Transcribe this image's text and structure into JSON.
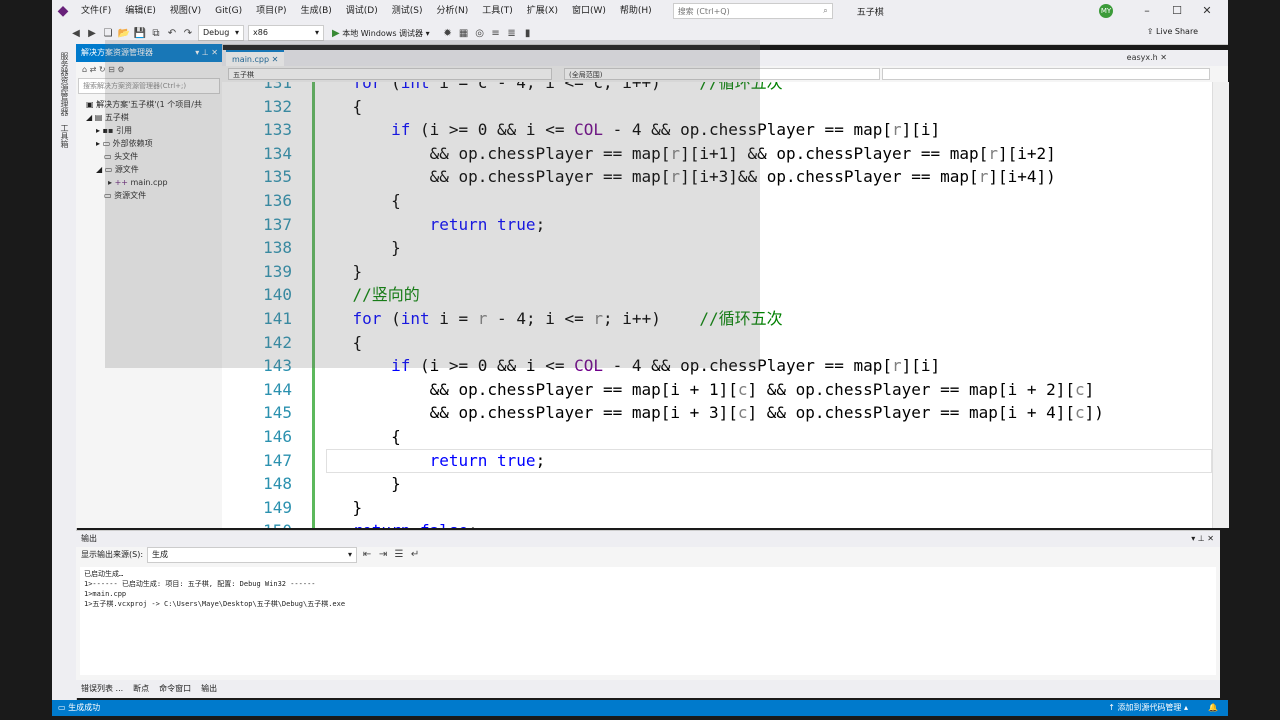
{
  "menu": {
    "items": [
      "文件(F)",
      "编辑(E)",
      "视图(V)",
      "Git(G)",
      "项目(P)",
      "生成(B)",
      "调试(D)",
      "测试(S)",
      "分析(N)",
      "工具(T)",
      "扩展(X)",
      "窗口(W)",
      "帮助(H)"
    ],
    "search_placeholder": "搜索 (Ctrl+Q)",
    "solution_name": "五子棋",
    "avatar": "MY"
  },
  "toolbar": {
    "config": "Debug",
    "platform": "x86",
    "run_label": "本地 Windows 调试器",
    "live_share": "Live Share"
  },
  "left_strip": {
    "tabs": [
      "服务器资源管理器",
      "工具箱"
    ]
  },
  "solution_explorer": {
    "title": "解决方案资源管理器",
    "search_placeholder": "搜索解决方案资源管理器(Ctrl+;)",
    "tree": [
      "解决方案'五子棋'(1 个项目/共",
      "五子棋",
      "引用",
      "外部依赖项",
      "头文件",
      "源文件",
      "main.cpp",
      "资源文件"
    ]
  },
  "editor": {
    "tab": "main.cpp",
    "tab2": "easyx.h",
    "nav_project": "五子棋",
    "nav_scope": "(全局范围)"
  },
  "output": {
    "title": "输出",
    "source_label": "显示输出来源(S):",
    "source_value": "生成",
    "lines": [
      "已启动生成…",
      "1>------ 已启动生成: 项目: 五子棋, 配置: Debug Win32 ------",
      "1>main.cpp",
      "1>五子棋.vcxproj -> C:\\Users\\Maye\\Desktop\\五子棋\\Debug\\五子棋.exe"
    ]
  },
  "bottom_tabs": [
    "错误列表 ...",
    "断点",
    "命令窗口",
    "输出"
  ],
  "statusbar": {
    "left": "生成成功",
    "right": "添加到源代码管理"
  }
}
